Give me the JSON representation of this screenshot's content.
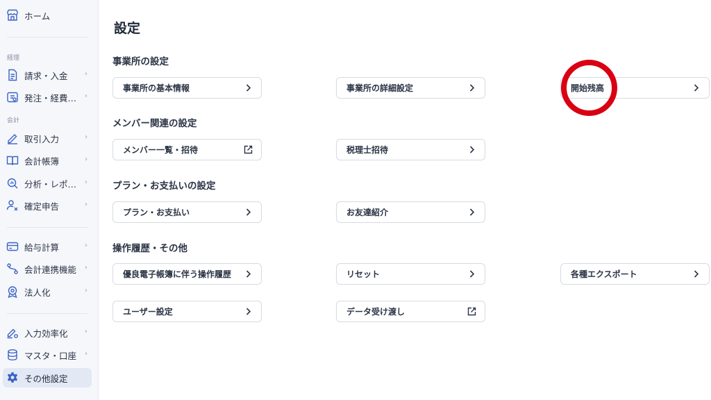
{
  "sidebar": {
    "home": {
      "label": "ホーム",
      "icon": "store-icon"
    },
    "sections": {
      "keiri": "経理",
      "kaikei": "会計"
    },
    "items": [
      {
        "label": "請求・入金",
        "icon": "invoice-icon"
      },
      {
        "label": "発注・経費…",
        "icon": "expense-icon"
      },
      {
        "label": "取引入力",
        "icon": "pen-icon"
      },
      {
        "label": "会計帳簿",
        "icon": "book-icon"
      },
      {
        "label": "分析・レポ…",
        "icon": "analytics-icon"
      },
      {
        "label": "確定申告",
        "icon": "tax-return-icon"
      },
      {
        "label": "給与計算",
        "icon": "payroll-icon"
      },
      {
        "label": "会計連携機能",
        "icon": "link-icon"
      },
      {
        "label": "法人化",
        "icon": "incorporation-icon"
      },
      {
        "label": "入力効率化",
        "icon": "efficiency-icon"
      },
      {
        "label": "マスタ・口座",
        "icon": "database-icon"
      },
      {
        "label": "その他設定",
        "icon": "gear-icon"
      }
    ],
    "active": "その他設定"
  },
  "main": {
    "title": "設定",
    "groups": [
      {
        "title": "事業所の設定",
        "cards": [
          {
            "label": "事業所の基本情報",
            "icon": "chevron-right-icon"
          },
          {
            "label": "事業所の詳細設定",
            "icon": "chevron-right-icon"
          },
          {
            "label": "開始残高",
            "icon": "chevron-right-icon"
          }
        ]
      },
      {
        "title": "メンバー関連の設定",
        "cards": [
          {
            "label": "メンバー一覧・招待",
            "icon": "external-link-icon"
          },
          {
            "label": "税理士招待",
            "icon": "chevron-right-icon"
          }
        ]
      },
      {
        "title": "プラン・お支払いの設定",
        "cards": [
          {
            "label": "プラン・お支払い",
            "icon": "chevron-right-icon"
          },
          {
            "label": "お友達紹介",
            "icon": "chevron-right-icon"
          }
        ]
      },
      {
        "title": "操作履歴・その他",
        "cards": [
          {
            "label": "優良電子帳簿に伴う操作履歴",
            "icon": "chevron-right-icon"
          },
          {
            "label": "リセット",
            "icon": "chevron-right-icon"
          },
          {
            "label": "各種エクスポート",
            "icon": "chevron-right-icon"
          },
          {
            "label": "ユーザー設定",
            "icon": "chevron-right-icon"
          },
          {
            "label": "データ受け渡し",
            "icon": "external-link-icon"
          }
        ]
      }
    ]
  },
  "annotation": {
    "color": "#d90012",
    "target": "開始残高"
  },
  "colors": {
    "accent": "#3b63c4",
    "sidebar_bg": "#f5f7fb",
    "active_bg": "#e3e9f4"
  }
}
